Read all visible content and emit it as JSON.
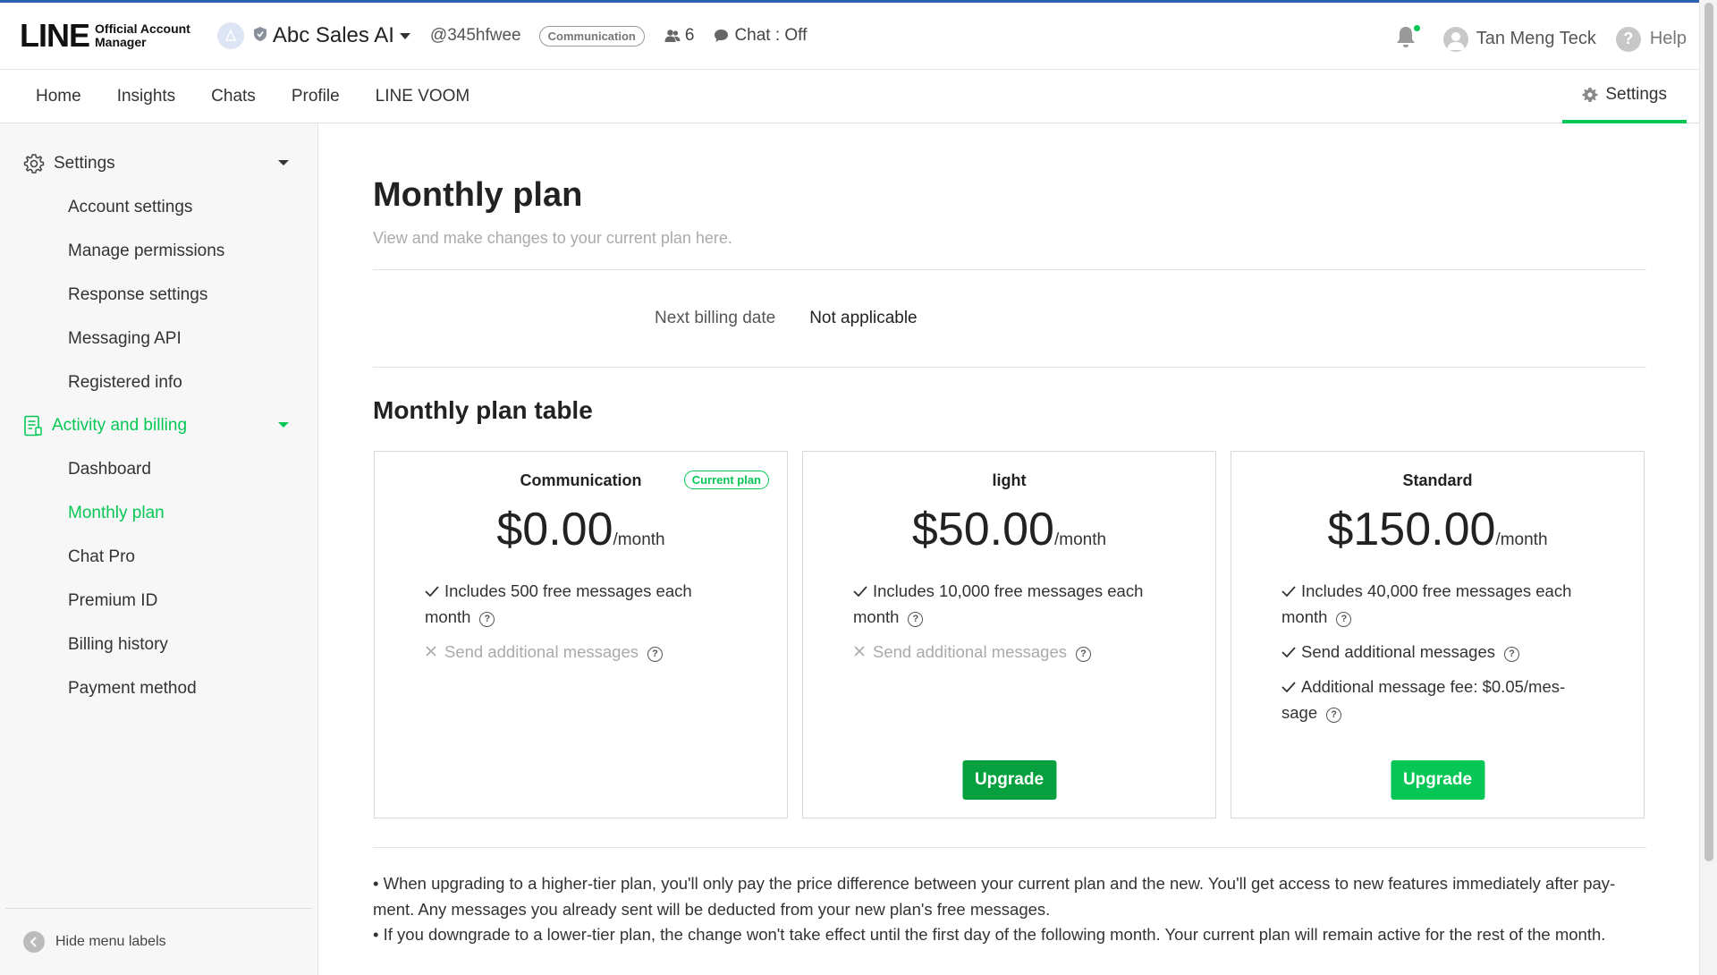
{
  "brand": {
    "logo_main": "LINE",
    "logo_sub1": "Official Account",
    "logo_sub2": "Manager"
  },
  "header": {
    "account_name": "Abc Sales AI",
    "account_id": "@345hfwee",
    "plan_badge": "Communication",
    "friends_count": "6",
    "chat_status": "Chat : Off",
    "user_name": "Tan Meng Teck",
    "help": "Help"
  },
  "nav": {
    "items": [
      "Home",
      "Insights",
      "Chats",
      "Profile",
      "LINE VOOM"
    ],
    "settings": "Settings"
  },
  "sidebar": {
    "settings_title": "Settings",
    "settings_items": [
      "Account settings",
      "Manage permissions",
      "Response settings",
      "Messaging API",
      "Registered info"
    ],
    "billing_title": "Activity and billing",
    "billing_items": [
      "Dashboard",
      "Monthly plan",
      "Chat Pro",
      "Premium ID",
      "Billing history",
      "Payment method"
    ],
    "active_item": "Monthly plan",
    "footer": "Hide menu labels"
  },
  "main": {
    "title": "Monthly plan",
    "subtitle": "View and make changes to your current plan here.",
    "billing_label": "Next billing date",
    "billing_value": "Not applicable",
    "table_title": "Monthly plan table",
    "plans": [
      {
        "name": "Communication",
        "badge": "Current plan",
        "price": "$0.00",
        "per": "/month",
        "f1": "Includes 500 free messages each month",
        "f2": "Send additional messages"
      },
      {
        "name": "light",
        "price": "$50.00",
        "per": "/month",
        "f1": "Includes 10,000 free messages each month",
        "f2": "Send additional messages",
        "button": "Upgrade"
      },
      {
        "name": "Standard",
        "price": "$150.00",
        "per": "/month",
        "f1": "Includes 40,000 free messages each month",
        "f2": "Send additional messages",
        "f3": "Additional message fee: $0.05/mes-sage",
        "button": "Upgrade"
      }
    ],
    "notes": [
      "• When upgrading to a higher-tier plan, you'll only pay the price difference between your current plan and the new. You'll get access to new features immediately after pay-ment. Any messages you already sent will be deducted from your new plan's free messages.",
      "• If you downgrade to a lower-tier plan, the change won't take effect until the first day of the following month. Your current plan will remain active for the rest of the month."
    ]
  },
  "colors": {
    "accent": "#06c755",
    "top_border": "#2b5fb2"
  }
}
